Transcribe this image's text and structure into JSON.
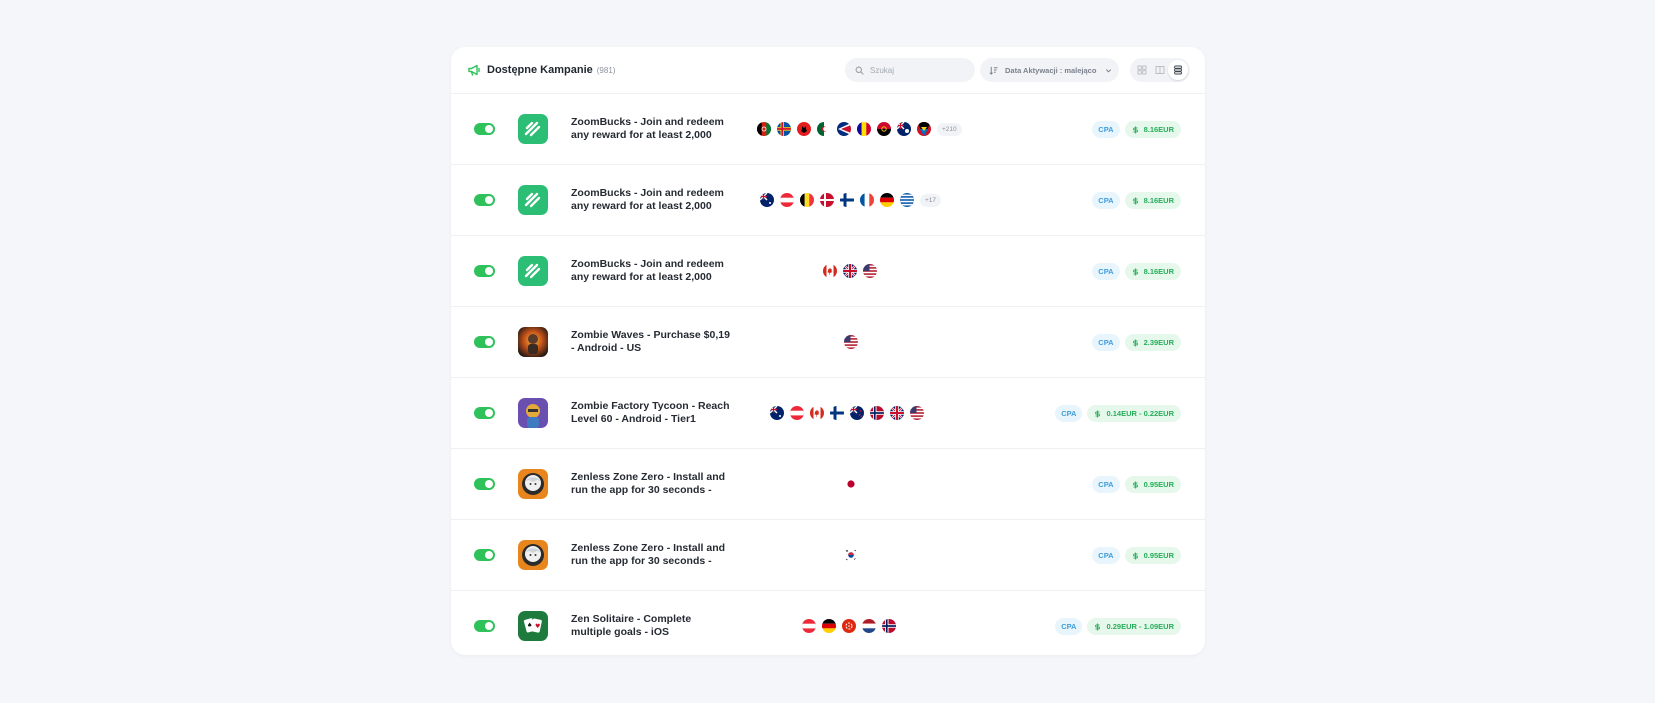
{
  "header": {
    "title": "Dostępne Kampanie",
    "count": "(981)",
    "search_placeholder": "Szukaj",
    "sort_label": "Data Aktywacji : malejąco",
    "views": [
      "grid-view",
      "card-view",
      "list-view"
    ],
    "active_view": "list-view"
  },
  "colors": {
    "accent_green": "#2fc25b",
    "cpa_blue": "#3f9edb",
    "payout_green": "#27ae5a"
  },
  "campaigns": [
    {
      "name": "ZoomBucks - Join and redeem any reward for at least 2,000",
      "icon": "zoombucks-icon",
      "enabled": true,
      "countries": [
        "AF",
        "AX",
        "AL",
        "DZ",
        "AS",
        "AD",
        "AO",
        "AI",
        "AG"
      ],
      "more": "+210",
      "type": "CPA",
      "payout": "8.16EUR"
    },
    {
      "name": "ZoomBucks - Join and redeem any reward for at least 2,000",
      "icon": "zoombucks-icon",
      "enabled": true,
      "countries": [
        "AU",
        "AT",
        "BE",
        "DK",
        "FI",
        "FR",
        "DE",
        "GR"
      ],
      "more": "+17",
      "type": "CPA",
      "payout": "8.16EUR"
    },
    {
      "name": "ZoomBucks - Join and redeem any reward for at least 2,000",
      "icon": "zoombucks-icon",
      "enabled": true,
      "countries": [
        "CA",
        "GB",
        "US"
      ],
      "more": "",
      "type": "CPA",
      "payout": "8.16EUR"
    },
    {
      "name": "Zombie Waves - Purchase $0,19 - Android - US",
      "icon": "zombie-waves-icon",
      "enabled": true,
      "countries": [
        "US"
      ],
      "more": "",
      "type": "CPA",
      "payout": "2.39EUR"
    },
    {
      "name": "Zombie Factory Tycoon - Reach Level 60 - Android - Tier1",
      "icon": "zombie-factory-icon",
      "enabled": true,
      "countries": [
        "AU",
        "AT",
        "CA",
        "FI",
        "NZ",
        "NO",
        "GB",
        "US"
      ],
      "more": "",
      "type": "CPA",
      "payout": "0.14EUR - 0.22EUR"
    },
    {
      "name": "Zenless Zone Zero - Install and run the app for 30 seconds -",
      "icon": "zenless-zone-zero-icon",
      "enabled": true,
      "countries": [
        "JP"
      ],
      "more": "",
      "type": "CPA",
      "payout": "0.95EUR"
    },
    {
      "name": "Zenless Zone Zero - Install and run the app for 30 seconds -",
      "icon": "zenless-zone-zero-icon",
      "enabled": true,
      "countries": [
        "KR"
      ],
      "more": "",
      "type": "CPA",
      "payout": "0.95EUR"
    },
    {
      "name": "Zen Solitaire - Complete multiple goals - iOS",
      "icon": "zen-solitaire-icon",
      "enabled": true,
      "countries": [
        "AT",
        "DE",
        "HK",
        "NL",
        "NO"
      ],
      "more": "",
      "type": "CPA",
      "payout": "0.29EUR - 1.09EUR"
    }
  ]
}
